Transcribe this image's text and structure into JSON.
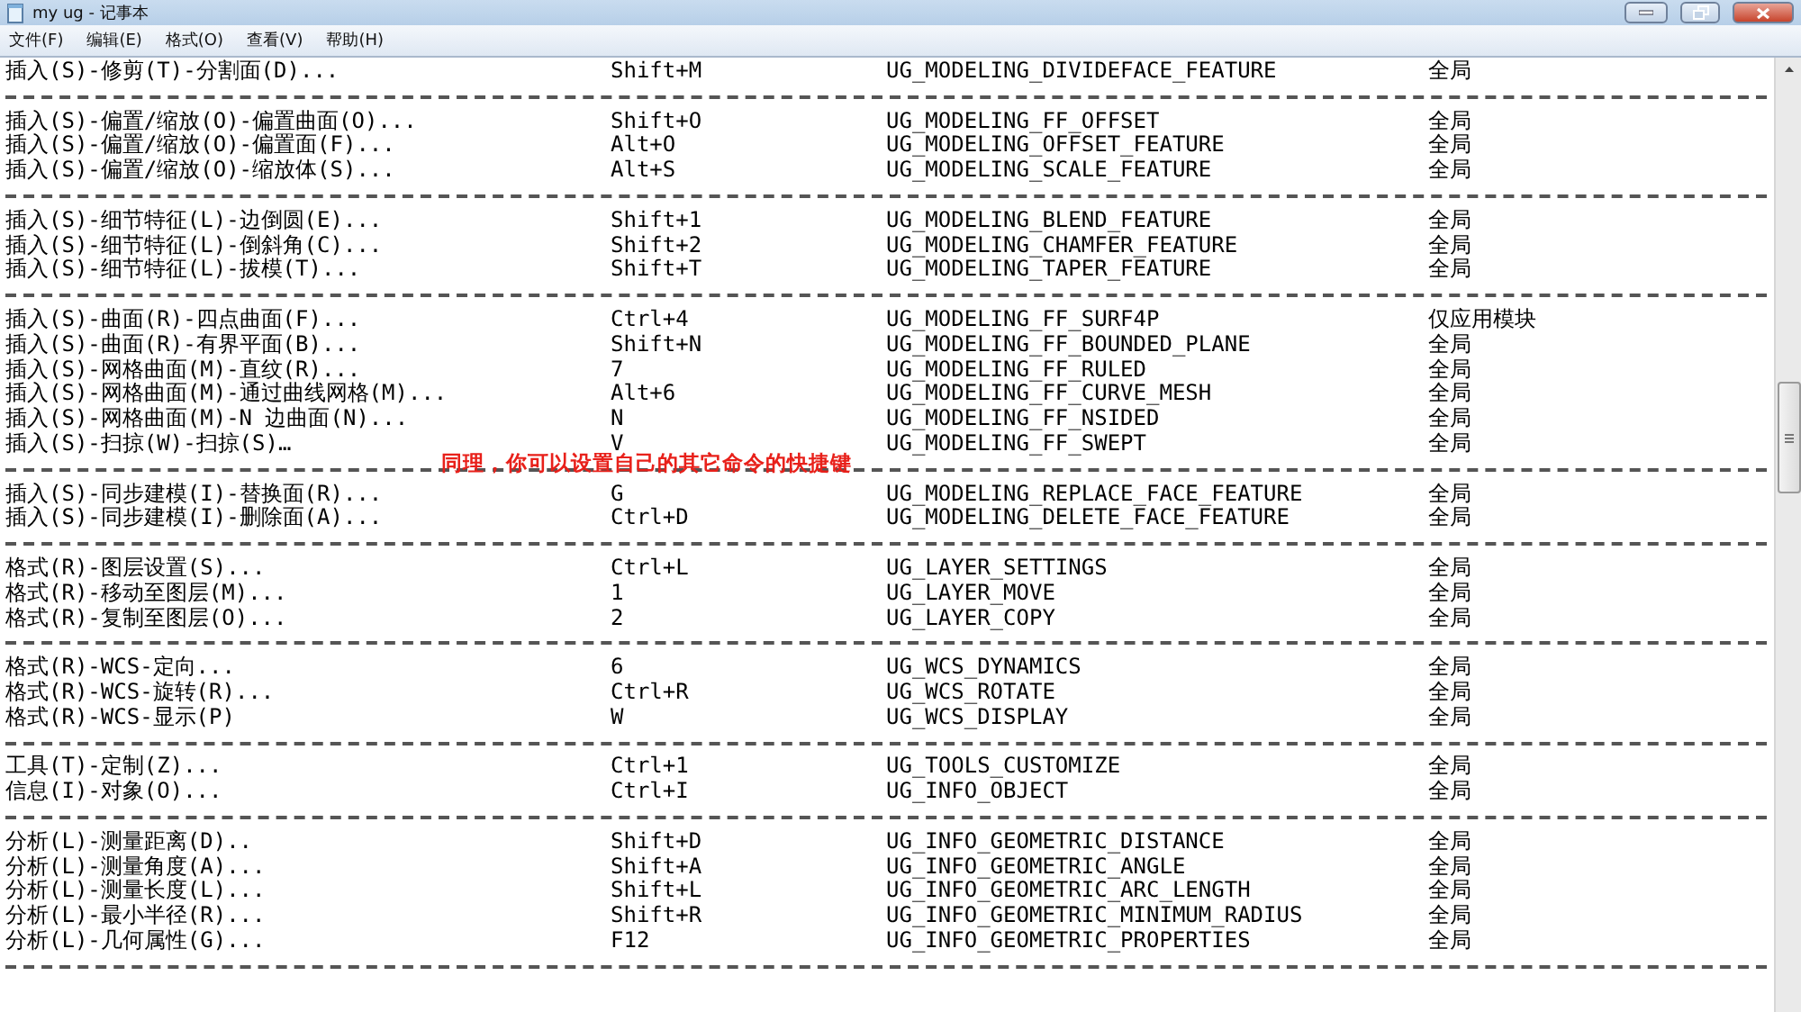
{
  "window": {
    "title": "my ug - 记事本"
  },
  "menu": [
    "文件(F)",
    "编辑(E)",
    "格式(O)",
    "查看(V)",
    "帮助(H)"
  ],
  "groups": [
    {
      "rows": [
        {
          "command": "插入(S)-修剪(T)-分割面(D)...",
          "shortcut": "Shift+M",
          "command_id": "UG_MODELING_DIVIDEFACE_FEATURE",
          "scope": "全局"
        }
      ]
    },
    {
      "rows": [
        {
          "command": "插入(S)-偏置/缩放(O)-偏置曲面(O)...",
          "shortcut": "Shift+O",
          "command_id": "UG_MODELING_FF_OFFSET",
          "scope": "全局"
        },
        {
          "command": "插入(S)-偏置/缩放(O)-偏置面(F)...",
          "shortcut": "Alt+O",
          "command_id": "UG_MODELING_OFFSET_FEATURE",
          "scope": "全局"
        },
        {
          "command": "插入(S)-偏置/缩放(O)-缩放体(S)...",
          "shortcut": "Alt+S",
          "command_id": "UG_MODELING_SCALE_FEATURE",
          "scope": "全局"
        }
      ]
    },
    {
      "rows": [
        {
          "command": "插入(S)-细节特征(L)-边倒圆(E)...",
          "shortcut": "Shift+1",
          "command_id": "UG_MODELING_BLEND_FEATURE",
          "scope": "全局"
        },
        {
          "command": "插入(S)-细节特征(L)-倒斜角(C)...",
          "shortcut": "Shift+2",
          "command_id": "UG_MODELING_CHAMFER_FEATURE",
          "scope": "全局"
        },
        {
          "command": "插入(S)-细节特征(L)-拔模(T)...",
          "shortcut": "Shift+T",
          "command_id": "UG_MODELING_TAPER_FEATURE",
          "scope": "全局"
        }
      ]
    },
    {
      "rows": [
        {
          "command": "插入(S)-曲面(R)-四点曲面(F)...",
          "shortcut": "Ctrl+4",
          "command_id": "UG_MODELING_FF_SURF4P",
          "scope": "仅应用模块"
        },
        {
          "command": "插入(S)-曲面(R)-有界平面(B)...",
          "shortcut": "Shift+N",
          "command_id": "UG_MODELING_FF_BOUNDED_PLANE",
          "scope": "全局"
        },
        {
          "command": "插入(S)-网格曲面(M)-直纹(R)...",
          "shortcut": "7",
          "command_id": "UG_MODELING_FF_RULED",
          "scope": "全局"
        },
        {
          "command": "插入(S)-网格曲面(M)-通过曲线网格(M)...",
          "shortcut": "Alt+6",
          "command_id": "UG_MODELING_FF_CURVE_MESH",
          "scope": "全局"
        },
        {
          "command": "插入(S)-网格曲面(M)-N 边曲面(N)...",
          "shortcut": "N",
          "command_id": "UG_MODELING_FF_NSIDED",
          "scope": "全局"
        },
        {
          "command": "插入(S)-扫掠(W)-扫掠(S)…",
          "shortcut": "V",
          "command_id": "UG_MODELING_FF_SWEPT",
          "scope": "全局"
        }
      ],
      "note": "同理，你可以设置自己的其它命令的快捷键"
    },
    {
      "rows": [
        {
          "command": "插入(S)-同步建模(I)-替换面(R)...",
          "shortcut": "G",
          "command_id": "UG_MODELING_REPLACE_FACE_FEATURE",
          "scope": "全局"
        },
        {
          "command": "插入(S)-同步建模(I)-删除面(A)...",
          "shortcut": "Ctrl+D",
          "command_id": "UG_MODELING_DELETE_FACE_FEATURE",
          "scope": "全局"
        }
      ]
    },
    {
      "rows": [
        {
          "command": "格式(R)-图层设置(S)...",
          "shortcut": "Ctrl+L",
          "command_id": "UG_LAYER_SETTINGS",
          "scope": "全局"
        },
        {
          "command": "格式(R)-移动至图层(M)...",
          "shortcut": "1",
          "command_id": "UG_LAYER_MOVE",
          "scope": "全局"
        },
        {
          "command": "格式(R)-复制至图层(O)...",
          "shortcut": "2",
          "command_id": "UG_LAYER_COPY",
          "scope": "全局"
        }
      ]
    },
    {
      "rows": [
        {
          "command": "格式(R)-WCS-定向...",
          "shortcut": "6",
          "command_id": "UG_WCS_DYNAMICS",
          "scope": "全局"
        },
        {
          "command": "格式(R)-WCS-旋转(R)...",
          "shortcut": "Ctrl+R",
          "command_id": "UG_WCS_ROTATE",
          "scope": "全局"
        },
        {
          "command": "格式(R)-WCS-显示(P)",
          "shortcut": "W",
          "command_id": "UG_WCS_DISPLAY",
          "scope": "全局"
        }
      ]
    },
    {
      "rows": [
        {
          "command": "工具(T)-定制(Z)...",
          "shortcut": "Ctrl+1",
          "command_id": "UG_TOOLS_CUSTOMIZE",
          "scope": "全局"
        },
        {
          "command": "信息(I)-对象(O)...",
          "shortcut": "Ctrl+I",
          "command_id": "UG_INFO_OBJECT",
          "scope": "全局"
        }
      ]
    },
    {
      "rows": [
        {
          "command": "分析(L)-测量距离(D)..",
          "shortcut": "Shift+D",
          "command_id": "UG_INFO_GEOMETRIC_DISTANCE",
          "scope": "全局"
        },
        {
          "command": "分析(L)-测量角度(A)...",
          "shortcut": "Shift+A",
          "command_id": "UG_INFO_GEOMETRIC_ANGLE",
          "scope": "全局"
        },
        {
          "command": "分析(L)-测量长度(L)...",
          "shortcut": "Shift+L",
          "command_id": "UG_INFO_GEOMETRIC_ARC_LENGTH",
          "scope": "全局"
        },
        {
          "command": "分析(L)-最小半径(R)...",
          "shortcut": "Shift+R",
          "command_id": "UG_INFO_GEOMETRIC_MINIMUM_RADIUS",
          "scope": "全局"
        },
        {
          "command": "分析(L)-几何属性(G)...",
          "shortcut": "F12",
          "command_id": "UG_INFO_GEOMETRIC_PROPERTIES",
          "scope": "全局"
        }
      ]
    }
  ]
}
